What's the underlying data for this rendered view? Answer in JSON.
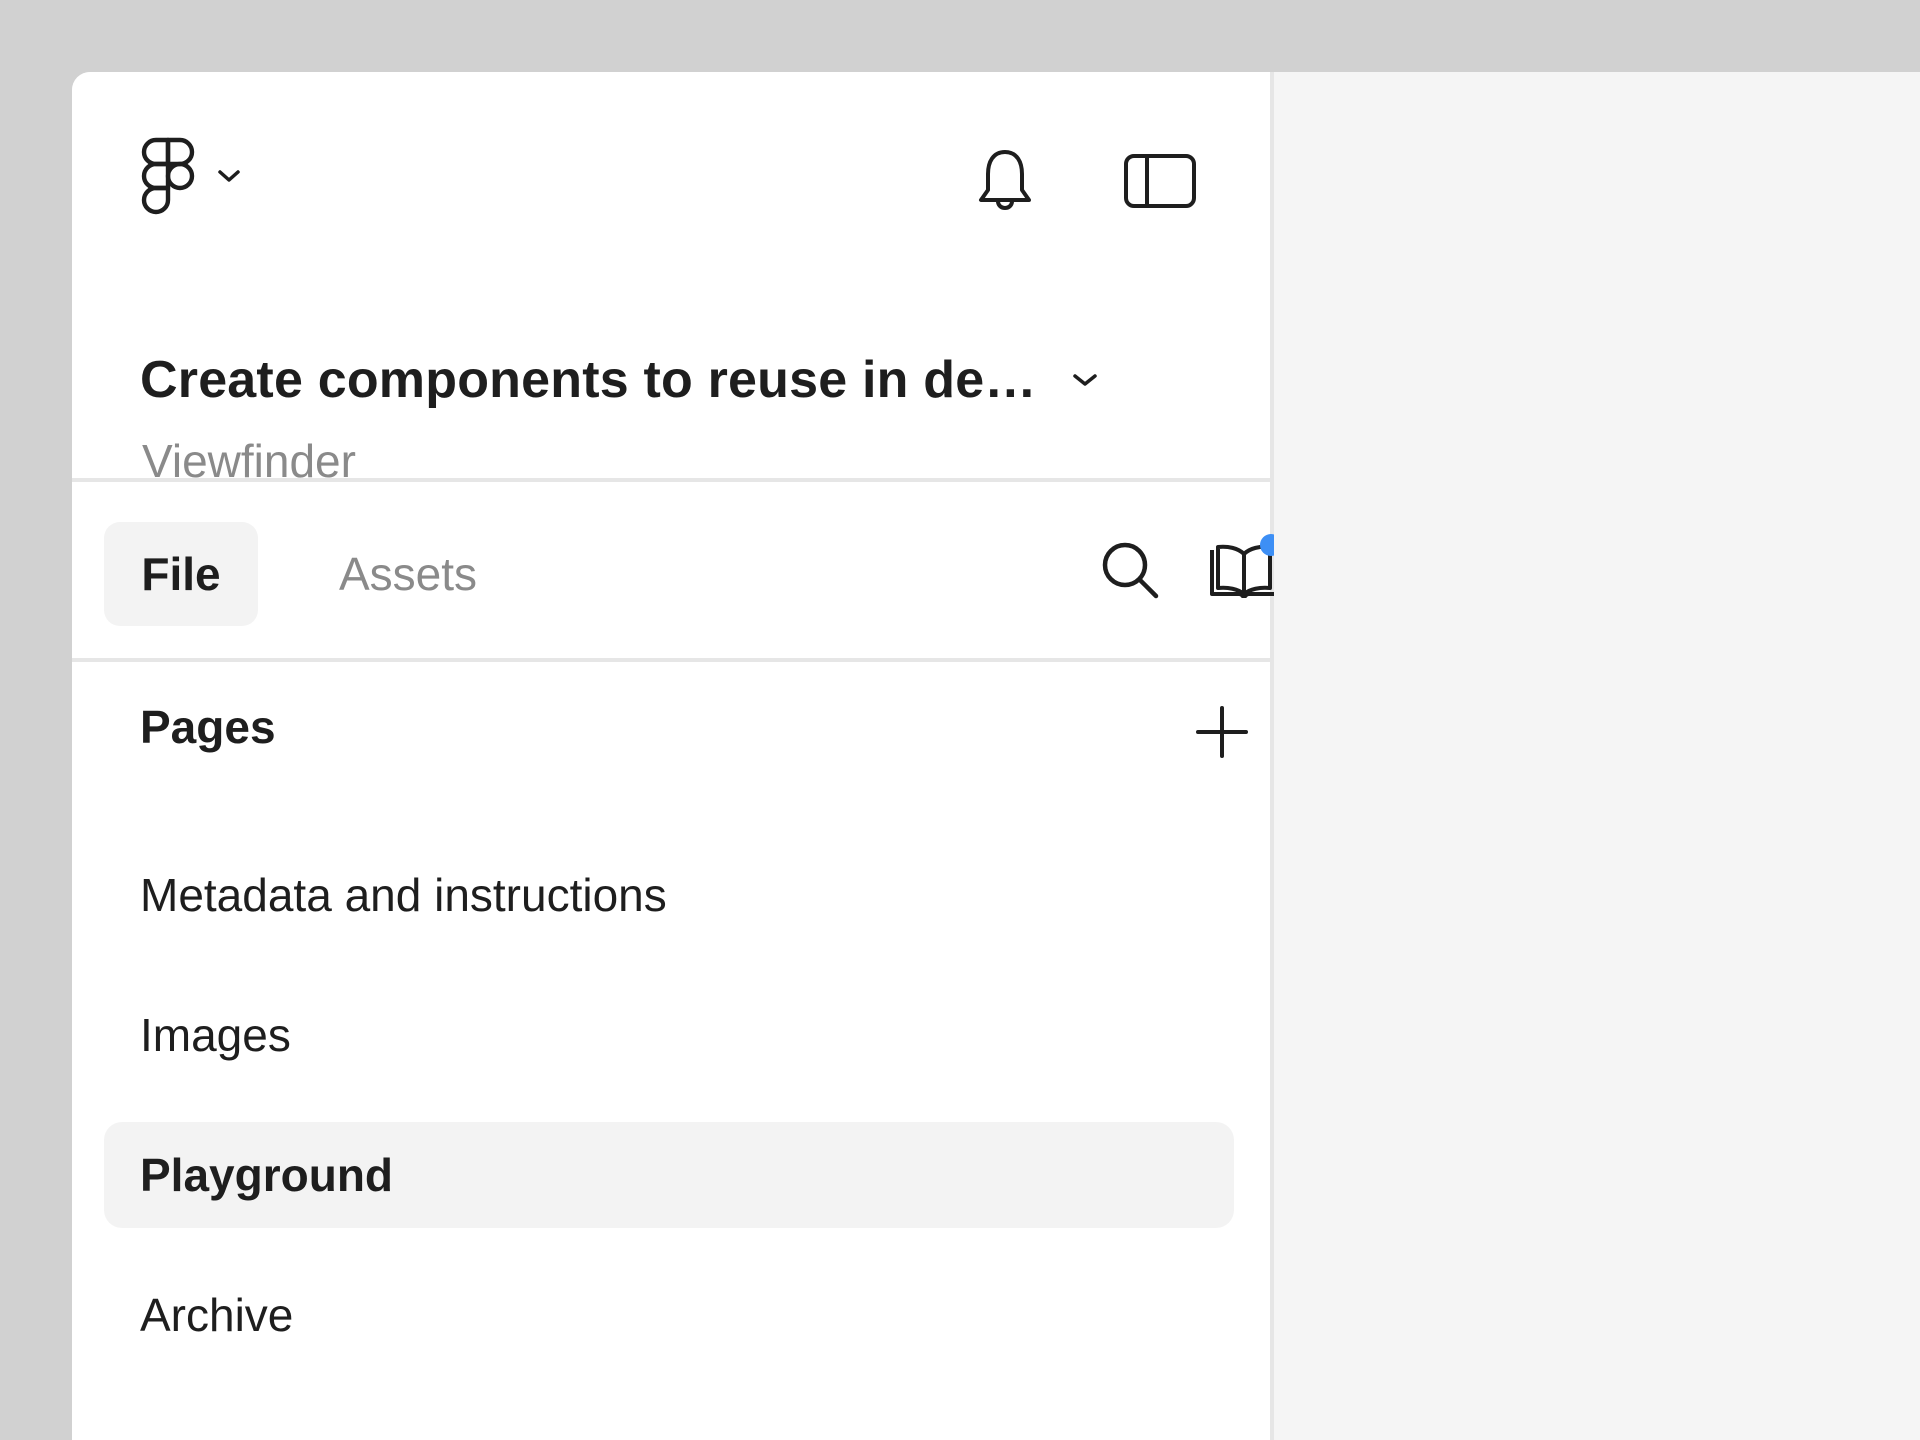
{
  "header": {
    "file_title": "Create components to reuse in de…",
    "project_name": "Viewfinder"
  },
  "tabs": [
    {
      "label": "File",
      "selected": true
    },
    {
      "label": "Assets",
      "selected": false
    }
  ],
  "pages": {
    "title": "Pages",
    "items": [
      {
        "label": "Metadata and instructions",
        "selected": false
      },
      {
        "label": "Images",
        "selected": false
      },
      {
        "label": "Playground",
        "selected": true
      },
      {
        "label": "Archive",
        "selected": false
      }
    ]
  },
  "icons": {
    "main_menu": "figma-logo-icon",
    "notifications": "bell-icon",
    "toggle_sidebar": "sidebar-panel-icon",
    "search": "search-icon",
    "library": "book-open-icon",
    "add_page": "plus-icon"
  },
  "colors": {
    "notification_dot": "#3d8ff5",
    "selected_bg": "#f3f3f3",
    "muted_text": "#8a8a8a"
  }
}
